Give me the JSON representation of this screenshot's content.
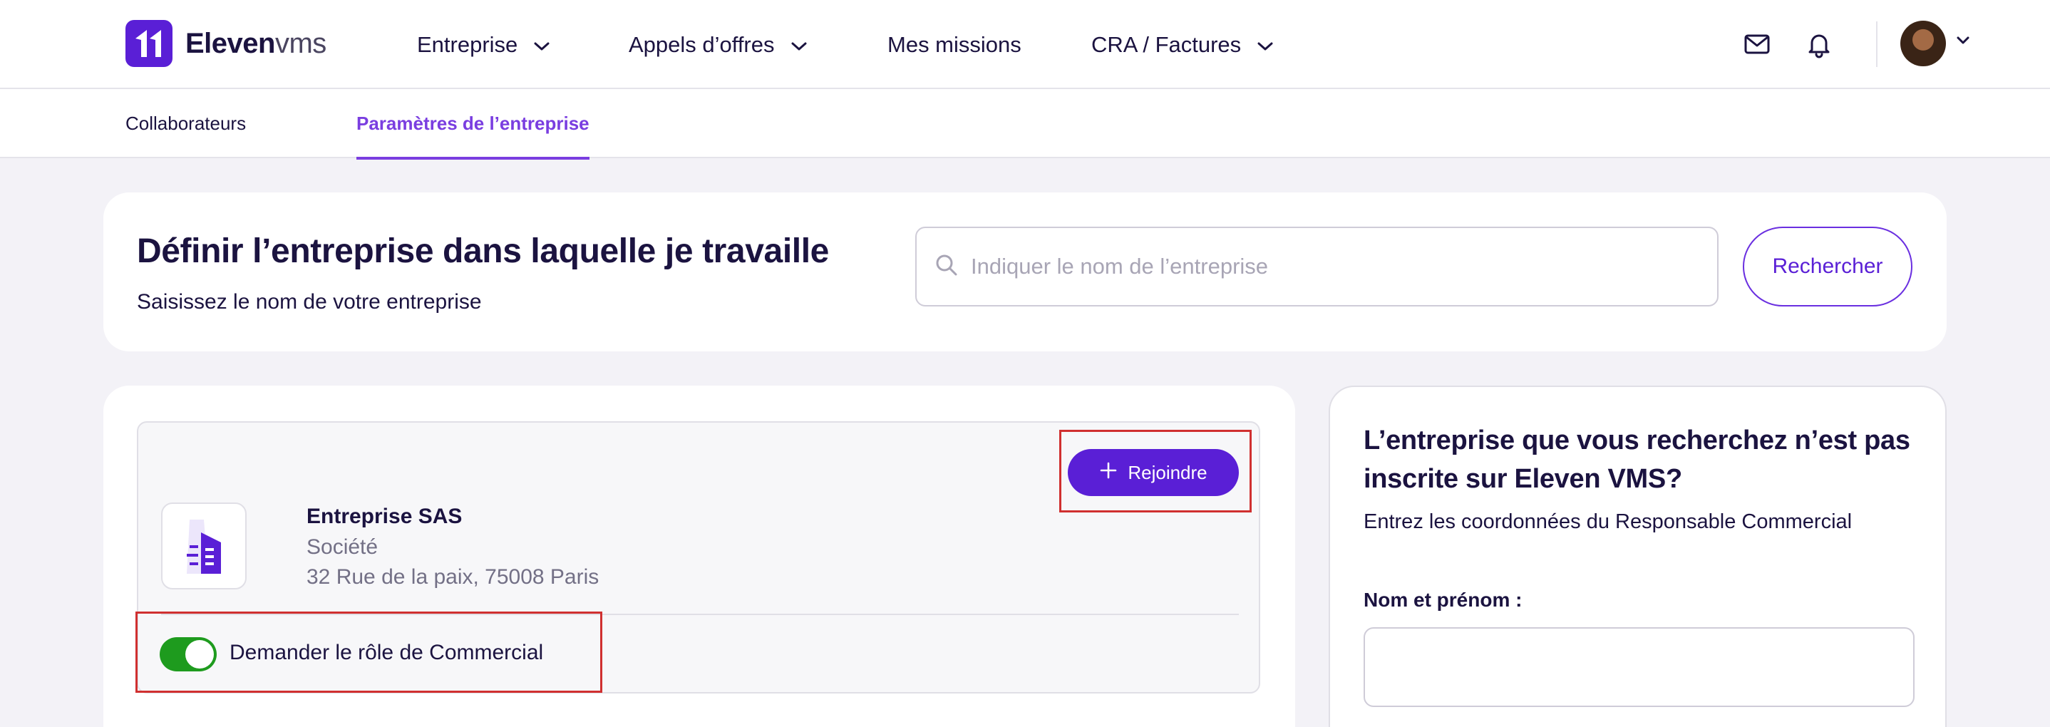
{
  "header": {
    "logo": {
      "brand_bold": "Eleven",
      "brand_light": "vms"
    },
    "nav": [
      {
        "label": "Entreprise",
        "has_dropdown": true
      },
      {
        "label": "Appels d’offres",
        "has_dropdown": true
      },
      {
        "label": "Mes missions",
        "has_dropdown": false
      },
      {
        "label": "CRA / Factures",
        "has_dropdown": true
      }
    ],
    "icons": [
      "mail-icon",
      "bell-icon",
      "avatar",
      "chevron-down-icon"
    ]
  },
  "subnav": {
    "tabs": [
      {
        "label": "Collaborateurs",
        "active": false
      },
      {
        "label": "Paramètres de l’entreprise",
        "active": true
      }
    ]
  },
  "search_card": {
    "title": "Définir l’entreprise dans laquelle je travaille",
    "subtitle": "Saisissez le nom de votre entreprise",
    "search_placeholder": "Indiquer le nom de l’entreprise",
    "search_value": "",
    "search_button": "Rechercher"
  },
  "company": {
    "join_button": "Rejoindre",
    "name": "Entreprise SAS",
    "type": "Société",
    "address": "32 Rue de la paix, 75008 Paris",
    "toggle_label": "Demander le rôle de Commercial",
    "toggle_on": true
  },
  "side_card": {
    "title": "L’entreprise que vous recherchez n’est pas inscrite sur Eleven VMS?",
    "subtitle": "Entrez les coordonnées du Responsable Commercial",
    "name_label": "Nom et prénom :",
    "name_value": ""
  },
  "colors": {
    "brand": "#5a1fd6",
    "active_tab": "#7a3ee0",
    "toggle_on": "#1e9b1e",
    "highlight": "#d03030",
    "background": "#f3f2f7"
  }
}
